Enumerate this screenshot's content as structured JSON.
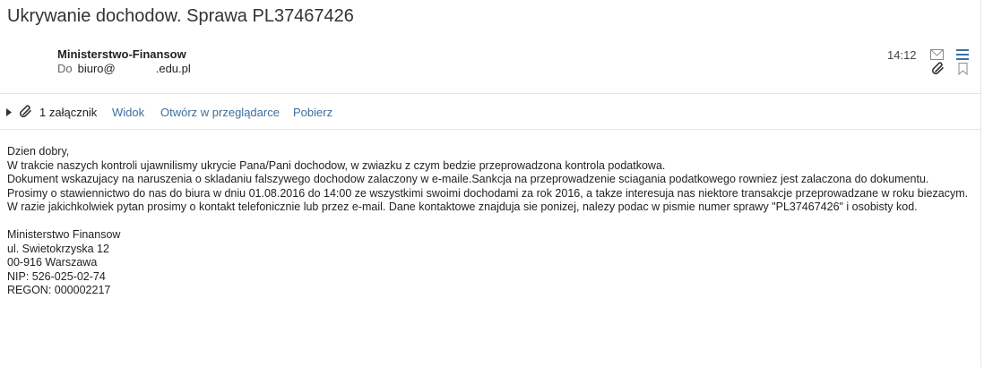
{
  "email": {
    "subject": "Ukrywanie dochodow. Sprawa PL37467426",
    "from": "Ministerstwo-Finansow",
    "to_label": "Do",
    "to_user": "biuro@",
    "to_domain": ".edu.pl",
    "time": "14:12"
  },
  "attachments": {
    "count_label": "1 załącznik",
    "view_label": "Widok",
    "open_label": "Otwórz w przeglądarce",
    "download_label": "Pobierz"
  },
  "body": {
    "greeting": "Dzien dobry,",
    "paragraphs": [
      "W trakcie naszych kontroli ujawnilismy ukrycie Pana/Pani dochodow, w zwiazku z czym bedzie przeprowadzona kontrola podatkowa.",
      "Dokument wskazujacy na naruszenia o skladaniu falszywego dochodow zalaczony w e-maile.Sankcja na przeprowadzenie sciagania podatkowego rowniez jest zalaczona do dokumentu.",
      "Prosimy o stawiennictwo do nas do biura w dniu 01.08.2016 do 14:00 ze wszystkimi swoimi dochodami za rok 2016, a takze interesuja nas niektore transakcje przeprowadzane w roku biezacym.",
      "W razie jakichkolwiek pytan prosimy o kontakt telefonicznie lub przez e-mail. Dane kontaktowe znajduja sie ponizej, nalezy podac w pismie numer sprawy \"PL37467426\" i osobisty kod."
    ],
    "signature": [
      "Ministerstwo Finansow",
      "ul. Swietokrzyska 12",
      "00-916 Warszawa",
      "NIP: 526-025-02-74",
      "REGON: 000002217"
    ]
  },
  "icons": {
    "mail": "envelope-icon",
    "menu": "menu-icon",
    "attachment": "paperclip-icon",
    "bookmark": "bookmark-icon",
    "expand": "expand-arrow-icon"
  },
  "colors": {
    "link": "#3d6e9e",
    "menu_icon": "#3d6e9e",
    "divider": "#e5e5e5"
  }
}
